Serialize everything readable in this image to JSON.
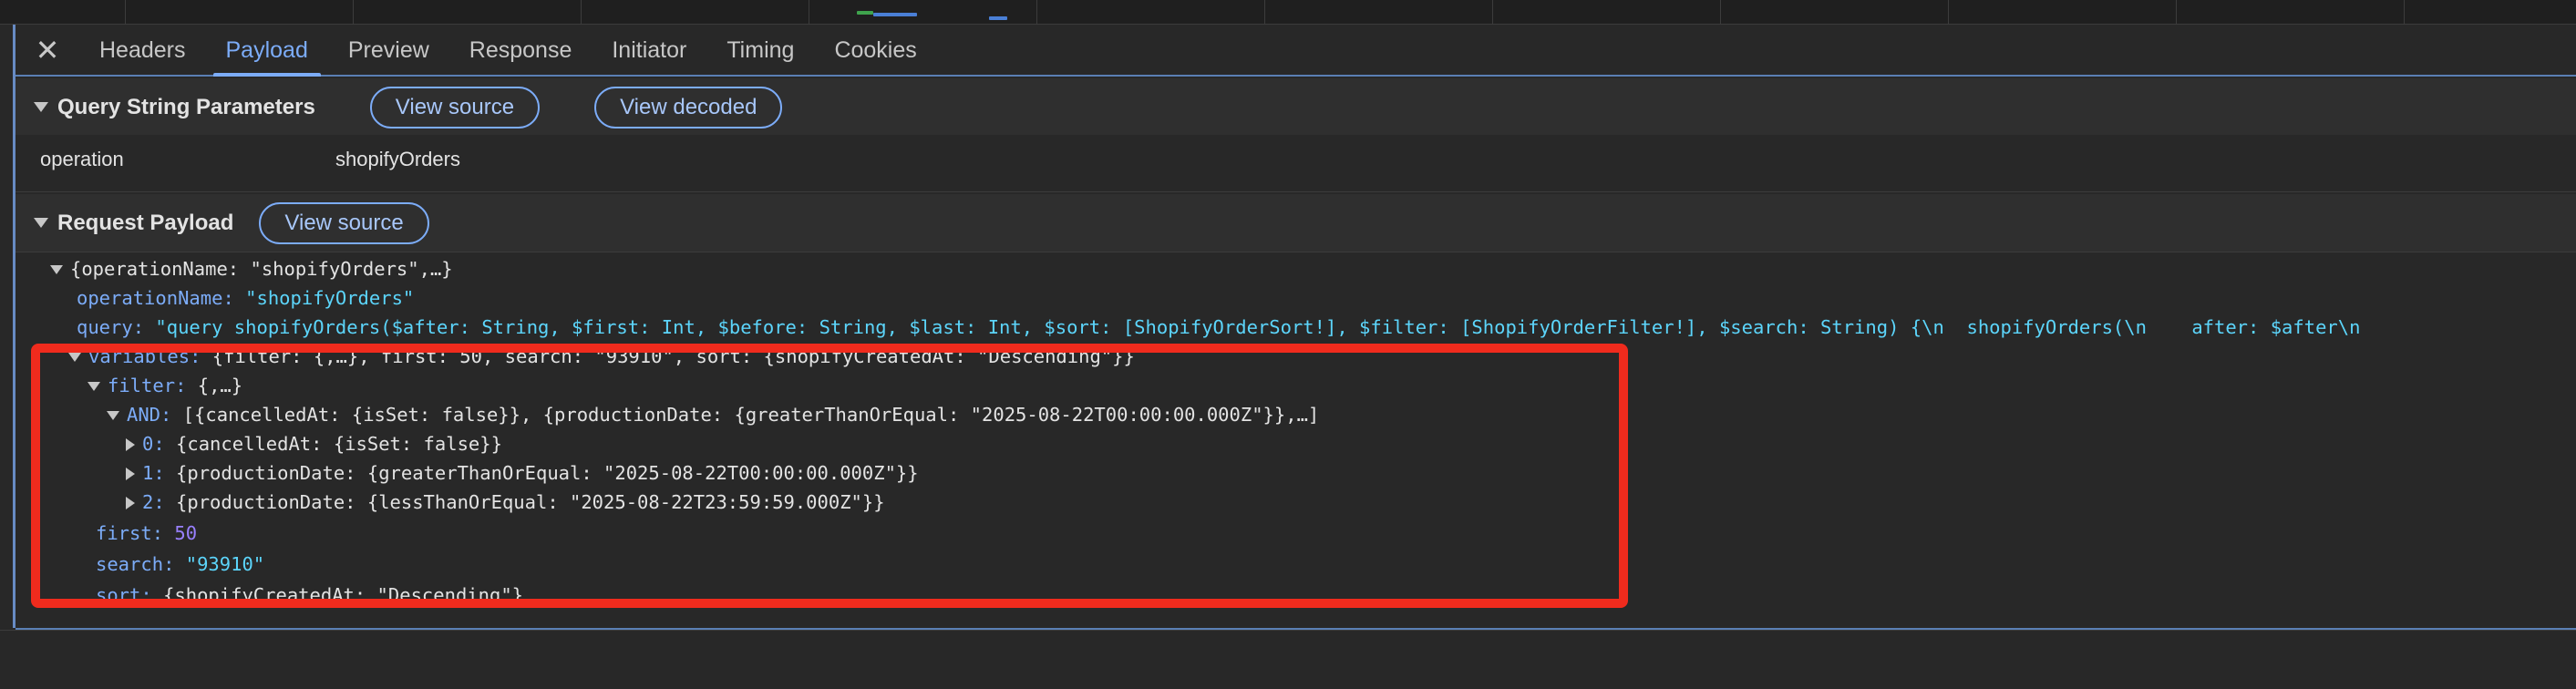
{
  "tabs": {
    "close_glyph": "✕",
    "items": [
      {
        "label": "Headers"
      },
      {
        "label": "Payload"
      },
      {
        "label": "Preview"
      },
      {
        "label": "Response"
      },
      {
        "label": "Initiator"
      },
      {
        "label": "Timing"
      },
      {
        "label": "Cookies"
      }
    ],
    "active": "Payload"
  },
  "query_string": {
    "title": "Query String Parameters",
    "view_source_label": "View source",
    "view_decoded_label": "View decoded",
    "params": [
      {
        "key": "operation",
        "value": "shopifyOrders"
      }
    ]
  },
  "request_payload": {
    "title": "Request Payload",
    "view_source_label": "View source",
    "root_summary": "{operationName: \"shopifyOrders\",…}",
    "operationName_key": "operationName",
    "operationName_value": "\"shopifyOrders\"",
    "query_key": "query",
    "query_value": "\"query shopifyOrders($after: String, $first: Int, $before: String, $last: Int, $sort: [ShopifyOrderSort!], $filter: [ShopifyOrderFilter!], $search: String) {\\n  shopifyOrders(\\n    after: $after\\n",
    "variables_key": "variables",
    "variables_summary": "{filter: {,…}, first: 50, search: \"93910\", sort: {shopifyCreatedAt: \"Descending\"}}",
    "filter_key": "filter",
    "filter_summary": "{,…}",
    "and_key": "AND",
    "and_summary": "[{cancelledAt: {isSet: false}}, {productionDate: {greaterThanOrEqual: \"2025-08-22T00:00:00.000Z\"}},…]",
    "and_items": [
      {
        "index": "0",
        "summary": "{cancelledAt: {isSet: false}}"
      },
      {
        "index": "1",
        "summary": "{productionDate: {greaterThanOrEqual: \"2025-08-22T00:00:00.000Z\"}}"
      },
      {
        "index": "2",
        "summary": "{productionDate: {lessThanOrEqual: \"2025-08-22T23:59:59.000Z\"}}"
      }
    ],
    "first_key": "first",
    "first_value": "50",
    "search_key": "search",
    "search_value": "\"93910\"",
    "sort_key": "sort",
    "sort_summary": "{shopifyCreatedAt: \"Descending\"}"
  },
  "colors": {
    "accent": "#7cacf8",
    "highlight_box": "#f02b1d",
    "string_value": "#5cd5fb",
    "number_value": "#9980ff"
  }
}
